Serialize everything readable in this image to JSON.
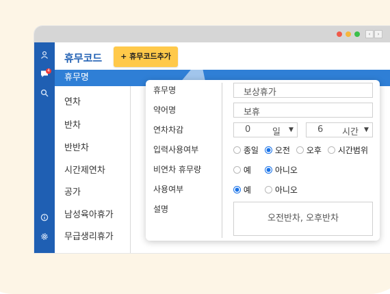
{
  "page_title": "휴무코드",
  "add_button_label": "+ 휴무코드추가",
  "window_controls": [
    "‹",
    "›"
  ],
  "sidebar_icons": [
    "user-icon",
    "chat-icon",
    "search-icon",
    "info-icon",
    "settings-icon"
  ],
  "notification_badge": "4",
  "list": {
    "header": "휴무명",
    "items": [
      "연차",
      "반차",
      "반반차",
      "시간제연차",
      "공가",
      "남성육아휴가",
      "무급생리휴가"
    ]
  },
  "form": {
    "labels": {
      "name": "휴무명",
      "abbr": "약어명",
      "deduct": "연차차감",
      "input_use": "입력사용여부",
      "non_annual": "비연차 휴무량",
      "use": "사용여부",
      "desc": "설명"
    },
    "name_value": "보상휴가",
    "abbr_value": "보휴",
    "deduct_days": "0",
    "deduct_days_unit": "일",
    "deduct_hours": "6",
    "deduct_hours_unit": "시간",
    "input_use_options": [
      "종일",
      "오전",
      "오후",
      "시간범위"
    ],
    "input_use_selected": "오전",
    "non_annual_options": [
      "예",
      "아니오"
    ],
    "non_annual_selected": "아니오",
    "use_options": [
      "예",
      "아니오"
    ],
    "use_selected": "예",
    "desc_value": "오전반차, 오후반차"
  },
  "colors": {
    "brand_blue": "#1f5fb3",
    "header_blue": "#2f7fd6",
    "accent_yellow": "#ffc94a",
    "radio_blue": "#1a73e8"
  }
}
